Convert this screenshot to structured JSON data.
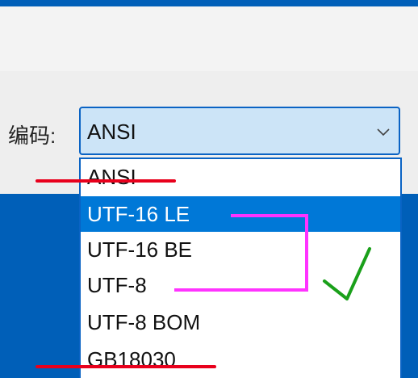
{
  "dialog": {
    "encoding_label": "编码:"
  },
  "encoding_combo": {
    "value": "ANSI",
    "chevron_icon": "chevron-down-icon"
  },
  "dropdown": {
    "options": [
      {
        "label": "ANSI",
        "struck": true
      },
      {
        "label": "UTF-16 LE",
        "selected": true
      },
      {
        "label": "UTF-16 BE"
      },
      {
        "label": "UTF-8"
      },
      {
        "label": "UTF-8 BOM"
      },
      {
        "label": "GB18030",
        "struck": true
      }
    ]
  },
  "annotations": {
    "strike_color": "#e8001c",
    "bracket_color": "#ff33ff",
    "check_color": "#1aa01a",
    "check_icon": "check-mark-icon"
  }
}
